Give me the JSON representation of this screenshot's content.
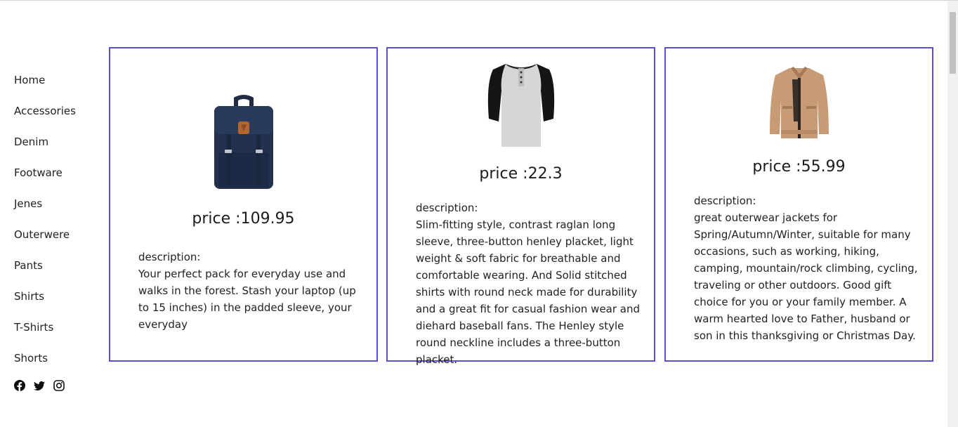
{
  "nav": {
    "items": [
      "Home",
      "Accessories",
      "Denim",
      "Footware",
      "Jenes",
      "Outerwere",
      "Pants",
      "Shirts",
      "T-Shirts",
      "Shorts"
    ]
  },
  "social": {
    "icons": [
      "facebook-icon",
      "twitter-icon",
      "instagram-icon"
    ]
  },
  "products": [
    {
      "price": "price :109.95",
      "desc_label": "description:",
      "description": "Your perfect pack for everyday use and walks in the forest. Stash your laptop (up to 15 inches) in the padded sleeve, your everyday"
    },
    {
      "price": "price :22.3",
      "desc_label": "description:",
      "description": "Slim-fitting style, contrast raglan long sleeve, three-button henley placket, light weight & soft fabric for breathable and comfortable wearing. And Solid stitched shirts with round neck made for durability and a great fit for casual fashion wear and diehard baseball fans. The Henley style round neckline includes a three-button placket."
    },
    {
      "price": "price :55.99",
      "desc_label": "description:",
      "description": "great outerwear jackets for Spring/Autumn/Winter, suitable for many occasions, such as working, hiking, camping, mountain/rock climbing, cycling, traveling or other outdoors. Good gift choice for you or your family member. A warm hearted love to Father, husband or son in this thanksgiving or Christmas Day."
    }
  ],
  "colors": {
    "card_border": "#5a4fd6",
    "text": "#222222"
  }
}
